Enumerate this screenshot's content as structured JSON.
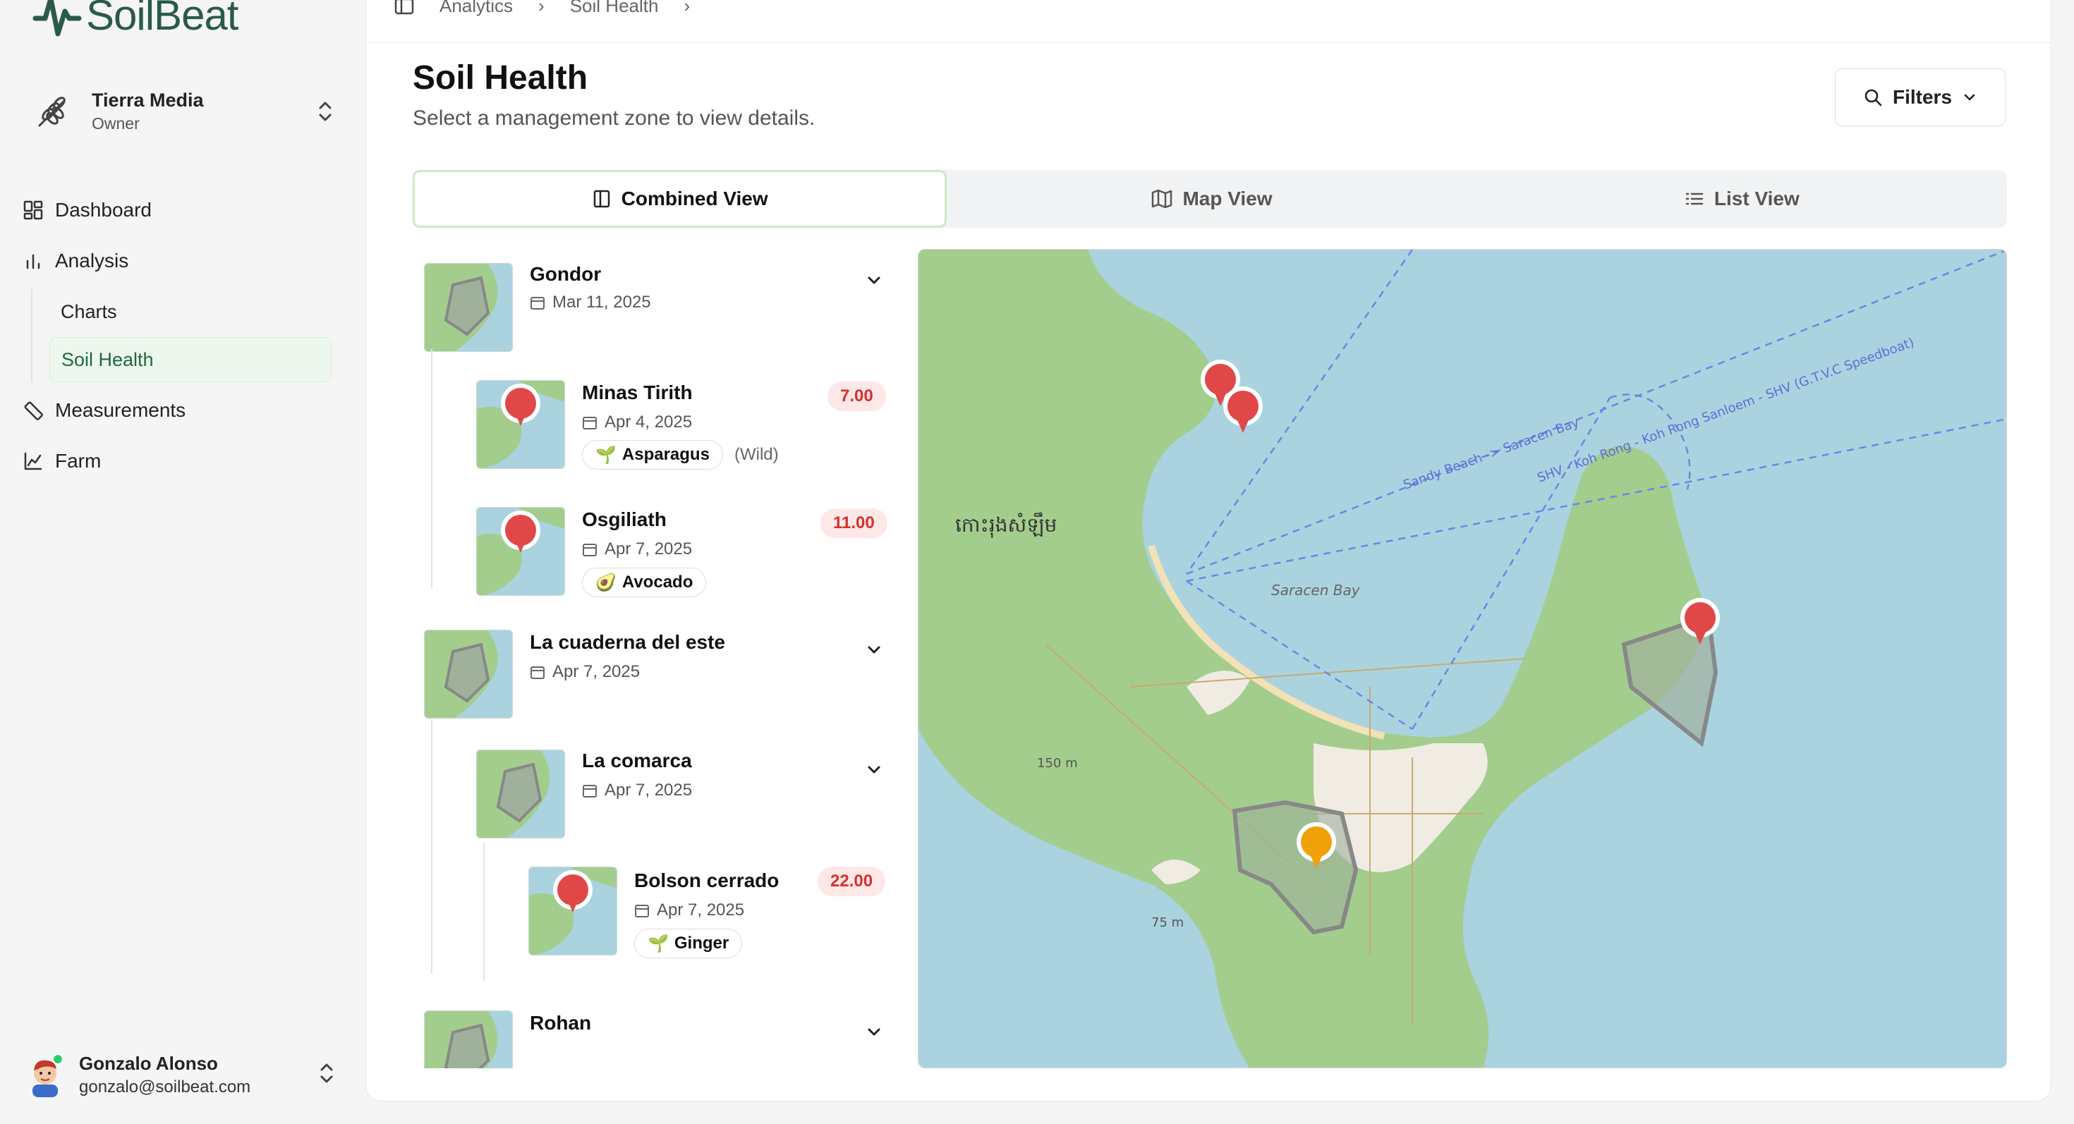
{
  "app": {
    "name": "SoilBeat"
  },
  "org": {
    "name": "Tierra Media",
    "role": "Owner"
  },
  "nav": {
    "dashboard": "Dashboard",
    "analysis": "Analysis",
    "charts": "Charts",
    "soil_health": "Soil Health",
    "measurements": "Measurements",
    "farm": "Farm"
  },
  "user": {
    "name": "Gonzalo Alonso",
    "email": "gonzalo@soilbeat.com"
  },
  "breadcrumb": {
    "items": [
      "Analytics",
      "Soil Health"
    ]
  },
  "page": {
    "title": "Soil Health",
    "subtitle": "Select a management zone to view details."
  },
  "filters": {
    "label": "Filters"
  },
  "tabs": {
    "combined": "Combined View",
    "map": "Map View",
    "list": "List View"
  },
  "zones": {
    "gondor": {
      "name": "Gondor",
      "date": "Mar 11, 2025",
      "minas": {
        "name": "Minas Tirith",
        "date": "Apr 4, 2025",
        "score": "7.00",
        "crop": "Asparagus",
        "crop_extra": "(Wild)"
      },
      "osgiliath": {
        "name": "Osgiliath",
        "date": "Apr 7, 2025",
        "score": "11.00",
        "crop": "Avocado"
      }
    },
    "cuaderna": {
      "name": "La cuaderna del este",
      "date": "Apr 7, 2025",
      "comarca": {
        "name": "La comarca",
        "date": "Apr 7, 2025",
        "bolson": {
          "name": "Bolson cerrado",
          "date": "Apr 7, 2025",
          "score": "22.00",
          "crop": "Ginger"
        }
      }
    },
    "rohan": {
      "name": "Rohan"
    }
  },
  "map_labels": {
    "island": "កោះរុងសំឡឹម",
    "bay": "Saracen Bay",
    "route1": "SHV - Koh Rong - Koh Rong Sanloem - SHV (G.T.V.C Speedboat)",
    "route2": "Sandy Beach -> Saracen Bay",
    "elev1": "150 m",
    "elev2": "75 m"
  },
  "colors": {
    "accent": "#2a5a4a",
    "active_bg": "#edf7ee",
    "marker_red": "#e04848",
    "marker_orange": "#f1a10a",
    "water": "#aad3df",
    "land": "#a3cd8d"
  }
}
